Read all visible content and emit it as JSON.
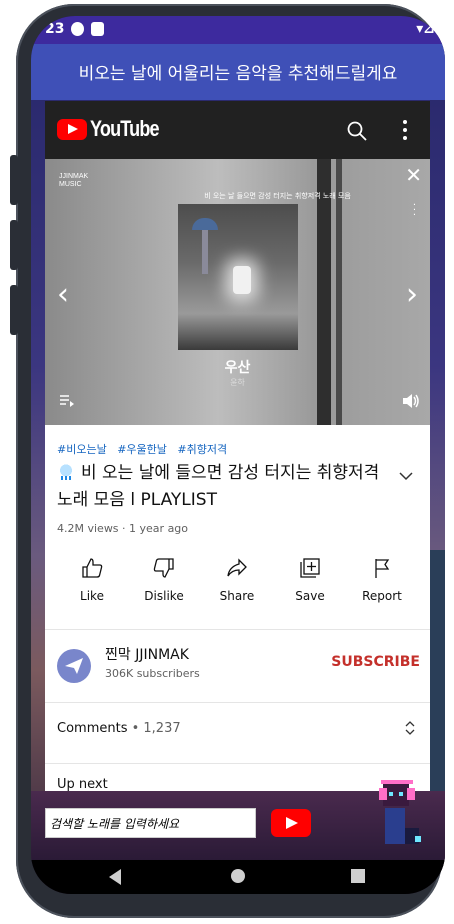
{
  "status_bar": {
    "time": "23",
    "signal": "▾⊿"
  },
  "app_bar": {
    "title": "비오는 날에 어울리는 음악을 추천해드릴게요"
  },
  "youtube": {
    "logo_text": "YouTube",
    "video": {
      "channel_mark": "JJINMAK\nMUSIC",
      "caption": "비 오는 날 들으면 감성 터지는 취향저격 노래 모음",
      "song_title": "우산",
      "song_artist": "윤하"
    },
    "hashtags": [
      "#비오는날",
      "#우울한날",
      "#취향저격"
    ],
    "title": "비 오는 날에 들으면 감성 터지는 취향저격 노래 모음 l PLAYLIST",
    "meta": "4.2M views · 1 year ago",
    "actions": [
      {
        "label": "Like",
        "icon": "thumbs-up-icon"
      },
      {
        "label": "Dislike",
        "icon": "thumbs-down-icon"
      },
      {
        "label": "Share",
        "icon": "share-icon"
      },
      {
        "label": "Save",
        "icon": "save-playlist-icon"
      },
      {
        "label": "Report",
        "icon": "flag-icon"
      }
    ],
    "channel": {
      "name": "찐막 JJINMAK",
      "subscribers": "306K subscribers",
      "subscribe_label": "SUBSCRIBE"
    },
    "comments": {
      "label": "Comments",
      "separator": " • ",
      "count": "1,237"
    },
    "up_next": "Up next"
  },
  "search": {
    "placeholder": "검색할 노래를 입력하세요"
  },
  "colors": {
    "app_bar": "#3f50b7",
    "youtube_red": "#ff0000",
    "subscribe": "#c4302b",
    "hashtag": "#1565c0"
  }
}
